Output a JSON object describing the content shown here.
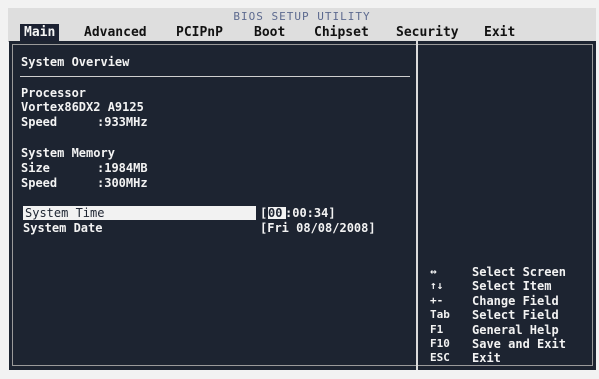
{
  "title": "BIOS SETUP UTILITY",
  "menu": [
    "Main",
    "Advanced",
    "PCIPnP",
    "Boot",
    "Chipset",
    "Security",
    "Exit"
  ],
  "active_menu": "Main",
  "system_overview": {
    "title": "System Overview",
    "processor": {
      "heading": "Processor",
      "model": "Vortex86DX2 A9125",
      "speed_label": "Speed",
      "speed_value": ":933MHz"
    },
    "memory": {
      "heading": "System Memory",
      "size_label": "Size",
      "size_value": ":1984MB",
      "speed_label": "Speed",
      "speed_value": ":300MHz"
    }
  },
  "settings": {
    "time_label": "System Time",
    "time_value_hour": "00",
    "time_value_rest": ":00:34]",
    "time_open_bracket": "[",
    "date_label": "System Date",
    "date_value": "[Fri 08/08/2008]"
  },
  "help": [
    {
      "key": "↔",
      "desc": "Select Screen"
    },
    {
      "key": "↑↓",
      "desc": "Select Item"
    },
    {
      "key": "+-",
      "desc": "Change Field"
    },
    {
      "key": "Tab",
      "desc": "Select Field"
    },
    {
      "key": "F1",
      "desc": "General Help"
    },
    {
      "key": "F10",
      "desc": "Save and Exit"
    },
    {
      "key": "ESC",
      "desc": "Exit"
    }
  ],
  "colors": {
    "background": "#1d2431",
    "menubar": "#dedede",
    "text": "#f3f3f3",
    "highlight": "#f2f2f2"
  }
}
